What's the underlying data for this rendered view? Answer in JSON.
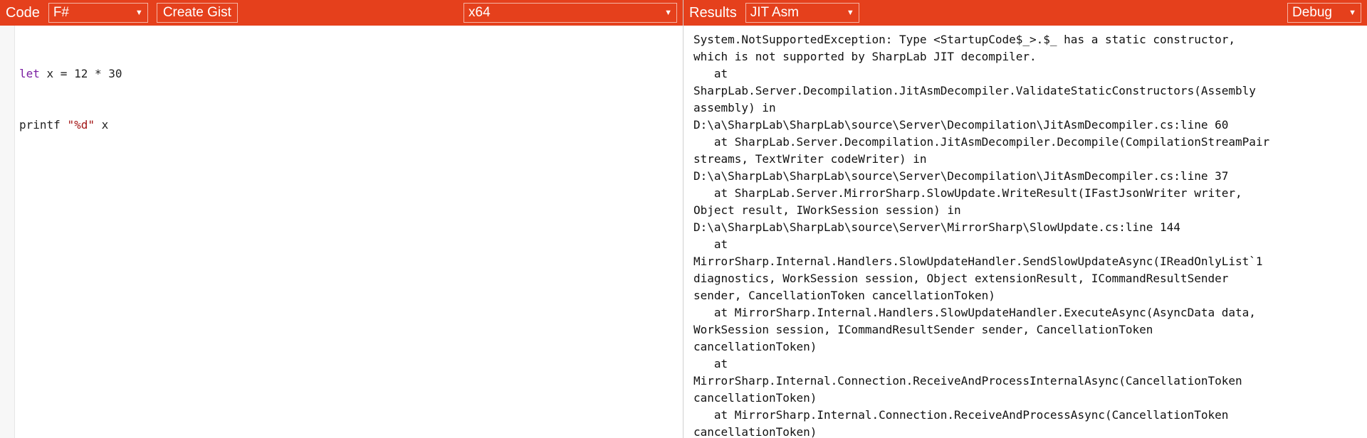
{
  "code_panel": {
    "title": "Code",
    "language": "F#",
    "create_gist_label": "Create Gist",
    "platform": "x64",
    "lines": [
      {
        "kw": "let",
        "rest": " x = 12 * 30"
      },
      {
        "pre": "printf ",
        "str": "\"%d\"",
        "post": " x"
      }
    ]
  },
  "results_panel": {
    "title": "Results",
    "mode": "JIT Asm",
    "build": "Debug",
    "output_lines": [
      "System.NotSupportedException: Type <StartupCode$_>.$_ has a static constructor,",
      "which is not supported by SharpLab JIT decompiler.",
      "   at",
      "SharpLab.Server.Decompilation.JitAsmDecompiler.ValidateStaticConstructors(Assembly",
      "assembly) in",
      "D:\\a\\SharpLab\\SharpLab\\source\\Server\\Decompilation\\JitAsmDecompiler.cs:line 60",
      "   at SharpLab.Server.Decompilation.JitAsmDecompiler.Decompile(CompilationStreamPair",
      "streams, TextWriter codeWriter) in",
      "D:\\a\\SharpLab\\SharpLab\\source\\Server\\Decompilation\\JitAsmDecompiler.cs:line 37",
      "   at SharpLab.Server.MirrorSharp.SlowUpdate.WriteResult(IFastJsonWriter writer,",
      "Object result, IWorkSession session) in",
      "D:\\a\\SharpLab\\SharpLab\\source\\Server\\MirrorSharp\\SlowUpdate.cs:line 144",
      "   at",
      "MirrorSharp.Internal.Handlers.SlowUpdateHandler.SendSlowUpdateAsync(IReadOnlyList`1",
      "diagnostics, WorkSession session, Object extensionResult, ICommandResultSender",
      "sender, CancellationToken cancellationToken)",
      "   at MirrorSharp.Internal.Handlers.SlowUpdateHandler.ExecuteAsync(AsyncData data,",
      "WorkSession session, ICommandResultSender sender, CancellationToken",
      "cancellationToken)",
      "   at",
      "MirrorSharp.Internal.Connection.ReceiveAndProcessInternalAsync(CancellationToken",
      "cancellationToken)",
      "   at MirrorSharp.Internal.Connection.ReceiveAndProcessAsync(CancellationToken",
      "cancellationToken)"
    ]
  },
  "icons": {
    "dropdown_arrow": "chevron-down-icon"
  },
  "colors": {
    "header_bg": "#e5401c",
    "keyword": "#7a1fa2",
    "string": "#a31515"
  }
}
